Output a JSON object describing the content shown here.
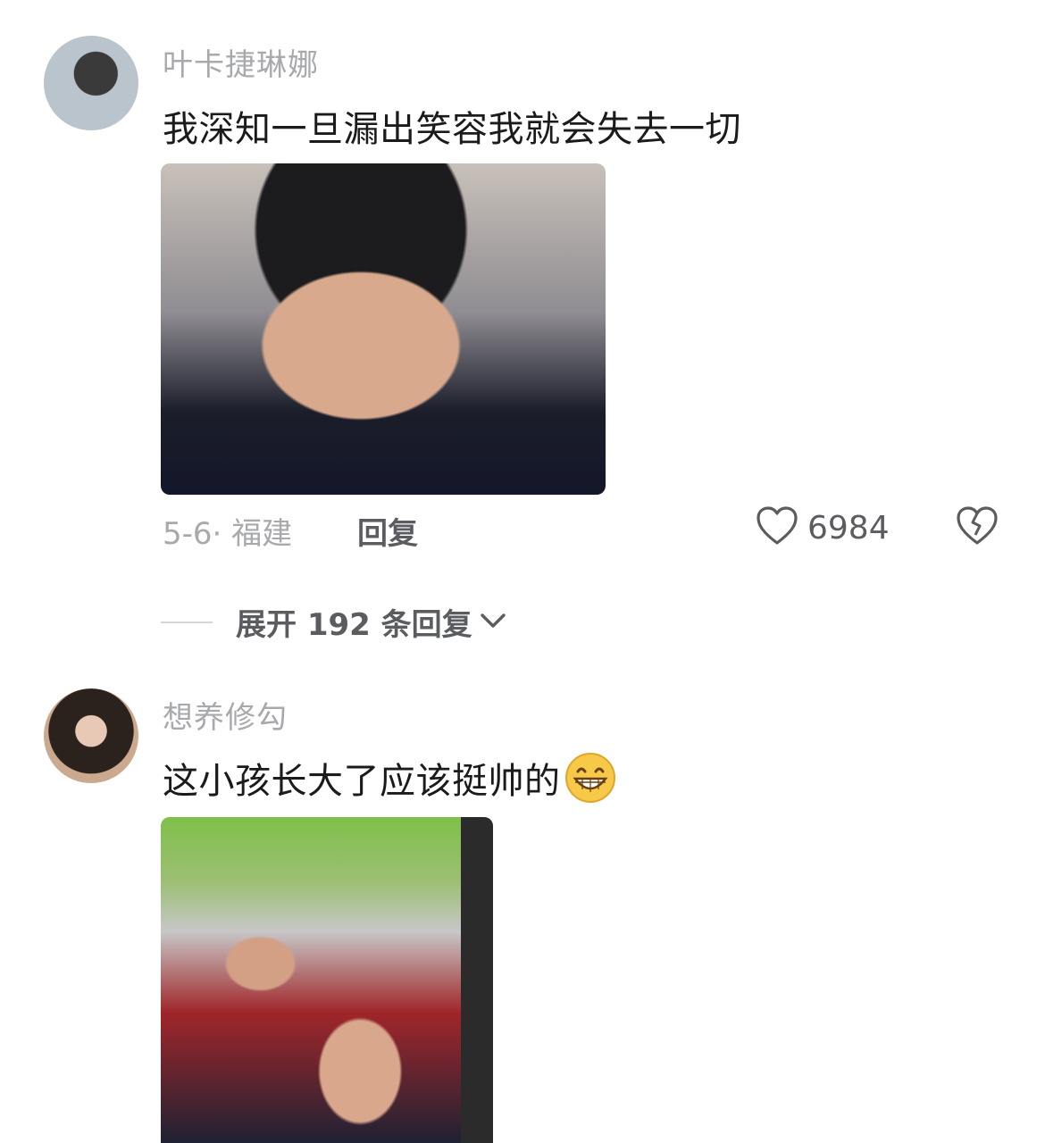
{
  "comments": [
    {
      "username": "叶卡捷琳娜",
      "text": "我深知一旦漏出笑容我就会失去一切",
      "date_location": "5-6· 福建",
      "reply_label": "回复",
      "like_count": "6984",
      "expand_label": "展开 192 条回复"
    },
    {
      "username": "想养修勾",
      "text": "这小孩长大了应该挺帅的"
    }
  ],
  "icons": {
    "like": "heart-outline-icon",
    "dislike": "broken-heart-icon",
    "expand": "chevron-down-icon",
    "emoji": "grinning-face-emoji"
  },
  "colors": {
    "username": "#a7a9ad",
    "text": "#1b1b1b",
    "secondary": "#5a5c60"
  }
}
